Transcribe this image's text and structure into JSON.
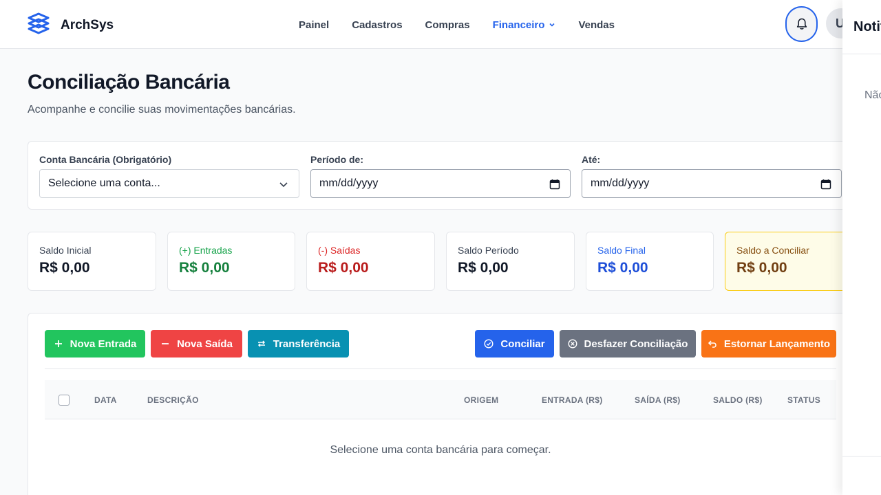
{
  "header": {
    "app_name": "ArchSys",
    "nav": [
      {
        "label": "Painel"
      },
      {
        "label": "Cadastros"
      },
      {
        "label": "Compras"
      },
      {
        "label": "Financeiro",
        "active": true
      },
      {
        "label": "Vendas"
      }
    ],
    "avatar_initial": "U",
    "icons": {
      "logo": "layers-logo-icon",
      "notifications": "bell-icon",
      "dropdown": "chevron-down-icon"
    }
  },
  "drawer": {
    "title": "Notificações",
    "empty_text": "Não há notificações"
  },
  "page": {
    "title": "Conciliação Bancária",
    "subtitle": "Acompanhe e concilie suas movimentações bancárias."
  },
  "filters": {
    "account_label": "Conta Bancária (Obrigatório)",
    "account_value": "Selecione uma conta...",
    "period_from_label": "Período de:",
    "period_from_value": "mm/dd/yyyy",
    "period_to_label": "Até:",
    "period_to_value": "mm/dd/yyyy"
  },
  "summary": [
    {
      "label": "Saldo Inicial",
      "value": "R$ 0,00"
    },
    {
      "label": "(+) Entradas",
      "value": "R$ 0,00"
    },
    {
      "label": "(-) Saídas",
      "value": "R$ 0,00"
    },
    {
      "label": "Saldo Período",
      "value": "R$ 0,00"
    },
    {
      "label": "Saldo Final",
      "value": "R$ 0,00"
    },
    {
      "label": "Saldo a Conciliar",
      "value": "R$ 0,00"
    }
  ],
  "actions": {
    "new_entry": "Nova Entrada",
    "new_exit": "Nova Saída",
    "transfer": "Transferência",
    "reconcile": "Conciliar",
    "undo_reconcile": "Desfazer Conciliação",
    "reverse": "Estornar Lançamento"
  },
  "table": {
    "columns": [
      "DATA",
      "DESCRIÇÃO",
      "ORIGEM",
      "ENTRADA (R$)",
      "SAÍDA (R$)",
      "SALDO (R$)",
      "STATUS"
    ],
    "empty_message": "Selecione uma conta bancária para começar."
  },
  "colors": {
    "primary": "#2563eb",
    "success": "#22c55e",
    "danger": "#ef4444",
    "info": "#0891b2",
    "neutral": "#6b7280",
    "warning": "#f97316"
  }
}
